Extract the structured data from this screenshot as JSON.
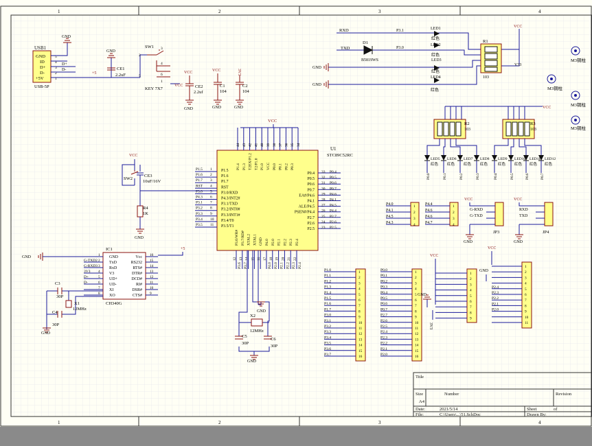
{
  "border": {
    "zones_top": [
      "1",
      "2",
      "3",
      "4"
    ],
    "zones_bottom": [
      "1",
      "2",
      "3",
      "4"
    ]
  },
  "usb": {
    "ref": "USB1",
    "type": "USB-5P",
    "pins": [
      "GND",
      "ID",
      "D+",
      "D-",
      "+5V"
    ],
    "pin_nums": [
      "5",
      "4",
      "3",
      "2",
      "1"
    ],
    "gnd": "GND",
    "net_dp": "D+",
    "net_dm": "D-",
    "plus5": "+5"
  },
  "ce1": {
    "ref": "CE1",
    "value": "2.2uF",
    "gnd": "GND"
  },
  "sw1": {
    "ref": "SW1",
    "type": "KEY 7X7",
    "pins": [
      "2",
      "3",
      "4",
      "5",
      "6",
      "1"
    ]
  },
  "ce2": {
    "ref": "CE2",
    "value": "2.2uf",
    "vcc": "VCC",
    "gnd": "GND"
  },
  "c1": {
    "ref": "C1",
    "value": "104",
    "vcc": "VCC",
    "gnd": "GND"
  },
  "c2": {
    "ref": "C2",
    "value": "104",
    "vcc": "3V3",
    "gnd": "GND"
  },
  "vcc_label": "VCC",
  "led_section": {
    "rxd": "RXD",
    "txd": "TXD",
    "d1": "D1",
    "d1_type": "B5819WS",
    "p31": "P3.1",
    "p30": "P3.0",
    "leds": [
      "LED1",
      "LED2",
      "LED3",
      "LED4"
    ],
    "led_color": "红色",
    "gnd1": "GND",
    "gnd2": "GND",
    "r1": "R1",
    "r1_value": "103",
    "vcc": "VCC",
    "v33": "V33"
  },
  "mounts": [
    "M3铜柱",
    "M3铜柱",
    "M3铜柱",
    "M3铜柱"
  ],
  "rpacks": {
    "r2": "R2",
    "r2_value": "103",
    "r3": "R3",
    "r3_value": "103",
    "vcc": "VCC",
    "leds": [
      "LED5",
      "LED6",
      "LED7",
      "LED8",
      "LED9",
      "LED10",
      "LED11",
      "LED12"
    ],
    "led_color": "红色",
    "nets": [
      "P0.0",
      "P0.1",
      "P0.2",
      "P0.3",
      "P0.4",
      "P0.5",
      "P0.6",
      "P0.7"
    ]
  },
  "mcu": {
    "ref": "U1",
    "type": "STC89C52RC",
    "vcc": "VCC",
    "top_pins": [
      "44",
      "43",
      "42",
      "41",
      "40",
      "39",
      "38",
      "37",
      "36",
      "35",
      "34"
    ],
    "top_labels": [
      "P1.4",
      "P1.3",
      "T2EX/P1.2",
      "T2/P1.0",
      "P1.0",
      "VCC",
      "P0.0",
      "P0.1",
      "P0.2",
      "P0.3"
    ],
    "left_nets": [
      "P1.5",
      "P1.6",
      "P1.7",
      "RST",
      "P3.0",
      "P4.3",
      "P3.1",
      "P3.2",
      "P3.3",
      "P3.4",
      "P3.5"
    ],
    "left_nums": [
      "1",
      "2",
      "3",
      "4",
      "5",
      "6",
      "7",
      "8",
      "9",
      "10",
      "11"
    ],
    "left_labels": [
      "P1.5",
      "P1.6",
      "P1.7",
      "RST",
      "P3.0/RXD",
      "P4.3/INT2#",
      "P3.1/TXD",
      "P3.2/INT0#",
      "P3.3/INT1#",
      "P3.4/T0",
      "P3.5/T1"
    ],
    "right_labels": [
      "P0.4",
      "P0.5",
      "P0.6",
      "P0.7",
      "EA#/P4.6",
      "P4.1",
      "ALE/P4.5",
      "PSEN#/P4.4",
      "P2.7",
      "P2.6",
      "P2.5"
    ],
    "right_nums": [
      "33",
      "32",
      "31",
      "30",
      "29",
      "28",
      "27",
      "26",
      "25",
      "24",
      "23"
    ],
    "right_nets": [
      "P0.4",
      "P0.5",
      "P0.6",
      "P0.7",
      "P4.6",
      "P4.1",
      "P4.5",
      "P4.4",
      "P2.7",
      "P2.6",
      "P2.5"
    ],
    "bottom_labels": [
      "P3.6/WR#",
      "P3.7/RD#",
      "XTAL2",
      "XTAL1",
      "GND",
      "P4.0",
      "P2.0",
      "P2.1",
      "P2.2",
      "P2.3",
      "P2.4"
    ],
    "bottom_nums": [
      "12",
      "13",
      "14",
      "15",
      "16",
      "17",
      "18",
      "19",
      "20",
      "21",
      "22"
    ],
    "bottom_nets": [
      "P3.6",
      "P3.7",
      "",
      "",
      "",
      "P4.0",
      "P2.0",
      "P2.1",
      "P2.2",
      "P2.3",
      "P2.4"
    ]
  },
  "reset": {
    "vcc": "VCC",
    "sw": "SW2",
    "ce3": "CE3",
    "ce3_value": "10uF/16V",
    "r4": "R4",
    "r4_value": "1K",
    "gnd": "GND"
  },
  "ch340": {
    "ref": "IC1",
    "type": "CH340G",
    "left_nets": [
      "",
      "G-TXD2",
      "G-RXD3",
      "3V3",
      "D+",
      "D-",
      "",
      ""
    ],
    "left_labels": [
      "GND",
      "TxD",
      "RxD",
      "V3",
      "UD+",
      "UD-",
      "XI",
      "XO"
    ],
    "left_nums": [
      "1",
      "2",
      "3",
      "4",
      "5",
      "6",
      "7",
      "8"
    ],
    "right_labels": [
      "Vcc",
      "RS232",
      "RTS#",
      "DTR#",
      "DCD#",
      "RI#",
      "DSR#",
      "CTS#"
    ],
    "right_nums": [
      "16",
      "15",
      "14",
      "13",
      "12",
      "11",
      "10",
      "9"
    ],
    "gnd": "GND",
    "plus5": "+5",
    "c3": "C3",
    "c3_value": "30P",
    "c4": "C4",
    "c4_value": "30P",
    "x1": "X1",
    "x1_value": "12MHz",
    "gnd2": "GND"
  },
  "xtal": {
    "x2": "X2",
    "x2_value": "12MHz",
    "c5": "C5",
    "c5_value": "30P",
    "c6": "C6",
    "c6_value": "30P",
    "gnd": "GND",
    "gnd_top": "GND"
  },
  "jp_p4": {
    "nets": [
      "P4.0",
      "P4.1",
      "P4.5",
      "P4.3"
    ]
  },
  "jp_p4b": {
    "nets": [
      "P4.4",
      "P4.6",
      "P4.6",
      "P4.7"
    ]
  },
  "jp3": {
    "ref": "JP3",
    "vcc": "VCC",
    "gnd": "GND",
    "nets": [
      "G-RXD",
      "G-TXD"
    ]
  },
  "jp4": {
    "ref": "JP4",
    "vcc": "VCC",
    "gnd": "GND",
    "nets": [
      "RXD",
      "TXD"
    ]
  },
  "hdr1": {
    "nets": [
      "P1.0",
      "P1.1",
      "P1.2",
      "P1.3",
      "P1.4",
      "P1.5",
      "P1.6",
      "P1.7",
      "P3.0",
      "P3.1",
      "P3.2",
      "P3.3",
      "P3.4",
      "P3.5",
      "P3.6",
      "P3.7"
    ],
    "nums": [
      "1",
      "2",
      "3",
      "4",
      "5",
      "6",
      "7",
      "8",
      "9",
      "10",
      "11",
      "12",
      "13",
      "14",
      "15",
      "16"
    ]
  },
  "hdr2": {
    "nets": [
      "P0.0",
      "P0.1",
      "P0.2",
      "P0.3",
      "P0.4",
      "P0.5",
      "P0.6",
      "P0.7",
      "P2.7",
      "P2.6",
      "P2.5",
      "P2.4",
      "P2.3",
      "P2.2",
      "P2.1",
      "P2.0"
    ],
    "nums": [
      "1",
      "2",
      "3",
      "4",
      "5",
      "6",
      "7",
      "8",
      "9",
      "10",
      "11",
      "12",
      "13",
      "14",
      "15",
      "16"
    ]
  },
  "hdr3": {
    "vcc": "VCC",
    "gnd": "GND",
    "v33": "3V3",
    "nums": [
      "1",
      "2",
      "3",
      "4",
      "5",
      "6",
      "7",
      "8",
      "9"
    ]
  },
  "hdr4": {
    "vcc": "VCC",
    "gnd": "GND",
    "nets": [
      "",
      "",
      "",
      "",
      "P2.4",
      "P2.3",
      "P2.2",
      "P2.1",
      "P2.0",
      "",
      ""
    ],
    "nums": [
      "1",
      "2",
      "3",
      "4",
      "5",
      "6",
      "7",
      "8",
      "9",
      "10",
      "11"
    ]
  },
  "title_block": {
    "title": "Title",
    "size": "Size",
    "size_val": "A4",
    "number": "Number",
    "revision": "Revision",
    "date": "Date:",
    "date_val": "2021/5/14",
    "sheet": "Sheet",
    "of": "of",
    "file": "File:",
    "file_val": "C:\\Users\\...\\51.SchDoc",
    "drawn": "Drawn By:"
  },
  "colors": {
    "sheet": "#fffff5",
    "grid": "#dcdce8",
    "wire": "#1a1a9a",
    "part": "#8a1010",
    "body": "#ffff8c",
    "text": "#111111",
    "power": "#8a1010"
  }
}
